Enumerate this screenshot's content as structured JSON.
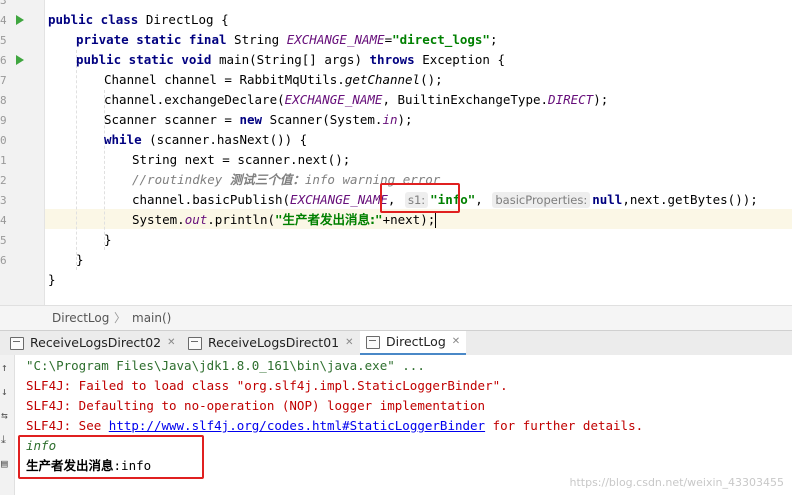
{
  "editor": {
    "line_numbers": [
      "3",
      "4",
      "5",
      "6",
      "7",
      "8",
      "9",
      "0",
      "1",
      "2",
      "3",
      "4",
      "5",
      "6"
    ],
    "code": {
      "l1": {
        "kw": "public class ",
        "rest": "DirectLog {"
      },
      "l2": {
        "kw": "private static final ",
        "type": "String ",
        "const": "EXCHANGE_NAME",
        "eq": "=",
        "str": "\"direct_logs\"",
        "end": ";"
      },
      "l3": {
        "kw": "public static void ",
        "sig": "main(String[] args) ",
        "kw2": "throws ",
        "rest": "Exception {"
      },
      "l4": {
        "a": "Channel channel = RabbitMqUtils.",
        "it": "getChannel",
        "b": "();"
      },
      "l5": {
        "a": "channel.exchangeDeclare(",
        "const": "EXCHANGE_NAME",
        "b": ", BuiltinExchangeType.",
        "const2": "DIRECT",
        "c": ");"
      },
      "l6": {
        "a": "Scanner scanner = ",
        "kw": "new ",
        "b": "Scanner(System.",
        "const": "in",
        "c": ");"
      },
      "l7": {
        "kw": "while ",
        "rest": "(scanner.hasNext()) {"
      },
      "l8": {
        "a": "String next = scanner.next();"
      },
      "l9": {
        "pre": "//routindkey ",
        "cn": "测试三个值：",
        "post": "info warning error"
      },
      "l10": {
        "a": "channel.basicPublish(",
        "const": "EXCHANGE_NAME",
        "b": ", ",
        "hint1": "s1:",
        "str": "\"info\"",
        "c": ", ",
        "hint2": "basicProperties:",
        "kw": "null",
        "d": ",next.getBytes());"
      },
      "l11": {
        "a": "System.",
        "const": "out",
        "b": ".println(",
        "str_open": "\"",
        "cn": "生产者发出消息:",
        "str_close": "\"",
        "c": "+next);"
      },
      "l12": {
        "a": "}"
      },
      "l13": {
        "a": "}"
      },
      "l14": {
        "a": "}"
      }
    }
  },
  "breadcrumb": {
    "class_name": "DirectLog",
    "method_name": "main()"
  },
  "tabs": [
    {
      "label": "ReceiveLogsDirect02"
    },
    {
      "label": "ReceiveLogsDirect01"
    },
    {
      "label": "DirectLog"
    }
  ],
  "console": {
    "lines": {
      "cmd": "\"C:\\Program Files\\Java\\jdk1.8.0_161\\bin\\java.exe\" ...",
      "e1": "SLF4J: Failed to load class \"org.slf4j.impl.StaticLoggerBinder\".",
      "e2": "SLF4J: Defaulting to no-operation (NOP) logger implementation",
      "e3_pre": "SLF4J: See ",
      "e3_link": "http://www.slf4j.org/codes.html#StaticLoggerBinder",
      "e3_post": " for further details.",
      "out1": "info",
      "out2_cn": "生产者发出消息",
      "out2_rest": ":info"
    }
  },
  "watermark": "https://blog.csdn.net/weixin_43303455",
  "colors": {
    "annotation_box": "#e02020",
    "keyword": "#000080",
    "string": "#008000",
    "constant": "#660e7a"
  }
}
